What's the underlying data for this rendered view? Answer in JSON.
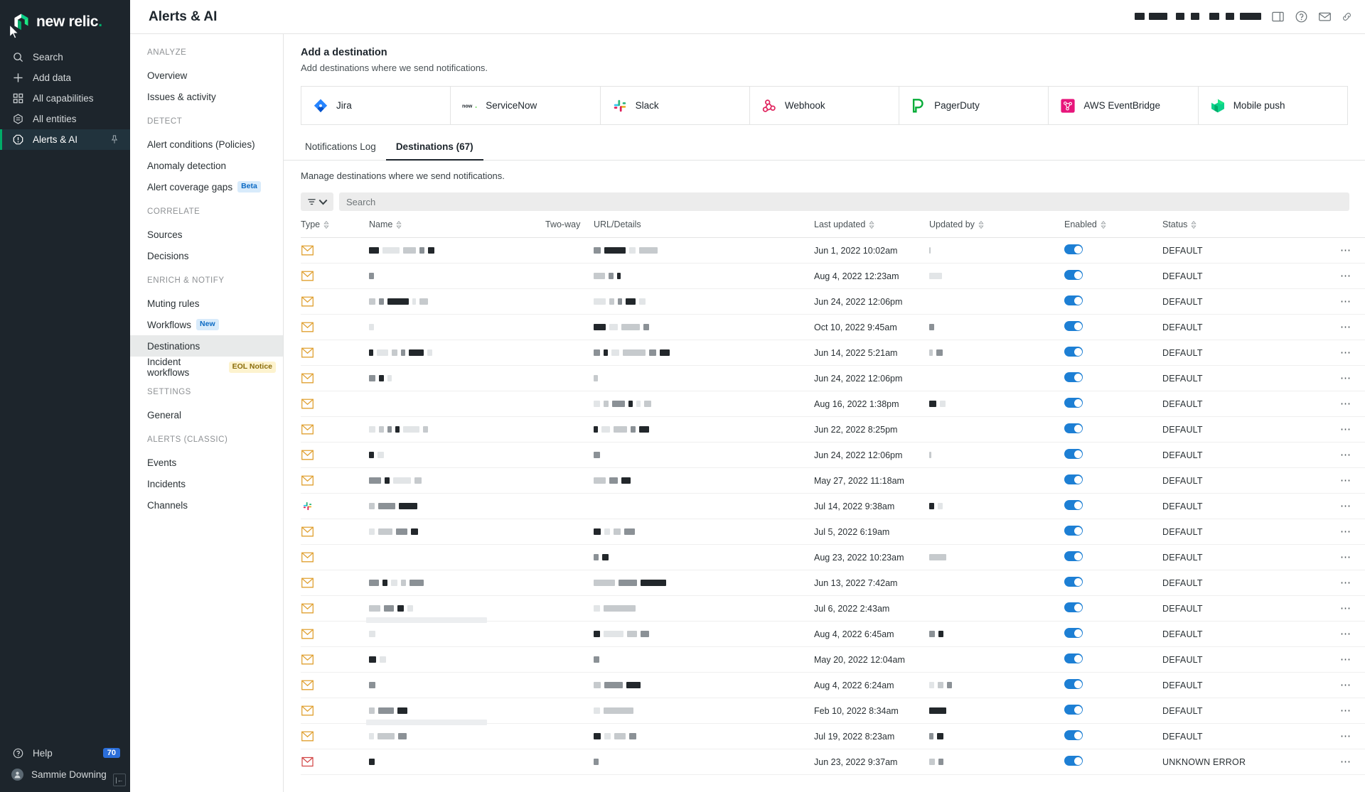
{
  "brand": {
    "name": "new relic",
    "accent": "#00ac69"
  },
  "primary_nav": {
    "items": [
      {
        "label": "Search",
        "icon": "search-icon"
      },
      {
        "label": "Add data",
        "icon": "plus-icon"
      },
      {
        "label": "All capabilities",
        "icon": "grid-icon"
      },
      {
        "label": "All entities",
        "icon": "hexagon-icon"
      },
      {
        "label": "Alerts & AI",
        "icon": "alert-octagon-icon",
        "active": true,
        "pinned": true
      }
    ],
    "help": {
      "label": "Help",
      "badge": "70",
      "icon": "help-circle-icon"
    },
    "user": {
      "label": "Sammie Downing",
      "icon": "avatar-icon"
    },
    "collapse": {
      "label": "|←"
    }
  },
  "header": {
    "title": "Alerts & AI",
    "icons": [
      "panel-icon",
      "help-circle-icon",
      "mail-icon",
      "link-icon"
    ]
  },
  "subnav": {
    "groups": [
      {
        "title": "ANALYZE",
        "items": [
          {
            "label": "Overview"
          },
          {
            "label": "Issues & activity"
          }
        ]
      },
      {
        "title": "DETECT",
        "items": [
          {
            "label": "Alert conditions (Policies)"
          },
          {
            "label": "Anomaly detection"
          },
          {
            "label": "Alert coverage gaps",
            "tag": "Beta",
            "tag_kind": "beta"
          }
        ]
      },
      {
        "title": "CORRELATE",
        "items": [
          {
            "label": "Sources"
          },
          {
            "label": "Decisions"
          }
        ]
      },
      {
        "title": "ENRICH & NOTIFY",
        "items": [
          {
            "label": "Muting rules"
          },
          {
            "label": "Workflows",
            "tag": "New",
            "tag_kind": "new"
          },
          {
            "label": "Destinations",
            "active": true
          },
          {
            "label": "Incident workflows",
            "tag": "EOL Notice",
            "tag_kind": "eol"
          }
        ]
      },
      {
        "title": "SETTINGS",
        "items": [
          {
            "label": "General"
          }
        ]
      },
      {
        "title": "ALERTS (CLASSIC)",
        "items": [
          {
            "label": "Events"
          },
          {
            "label": "Incidents"
          },
          {
            "label": "Channels"
          }
        ]
      }
    ]
  },
  "add_destination": {
    "title": "Add a destination",
    "subtitle": "Add destinations where we send notifications.",
    "cards": [
      {
        "label": "Jira",
        "logo": "jira-logo"
      },
      {
        "label": "ServiceNow",
        "logo": "servicenow-logo"
      },
      {
        "label": "Slack",
        "logo": "slack-logo"
      },
      {
        "label": "Webhook",
        "logo": "webhook-logo"
      },
      {
        "label": "PagerDuty",
        "logo": "pagerduty-logo"
      },
      {
        "label": "AWS EventBridge",
        "logo": "aws-eventbridge-logo"
      },
      {
        "label": "Mobile push",
        "logo": "mobile-push-logo"
      }
    ]
  },
  "tabs": [
    {
      "label": "Notifications Log",
      "active": false
    },
    {
      "label": "Destinations (67)",
      "active": true
    }
  ],
  "manage_text": "Manage destinations where we send notifications.",
  "toolbar": {
    "filter_label": "filter",
    "search_placeholder": "Search",
    "search_value": ""
  },
  "table": {
    "columns": [
      {
        "label": "Type",
        "sortable": true
      },
      {
        "label": "Name",
        "sortable": true
      },
      {
        "label": "Two-way",
        "sortable": false
      },
      {
        "label": "URL/Details",
        "sortable": false
      },
      {
        "label": "Last updated",
        "sortable": true
      },
      {
        "label": "Updated by",
        "sortable": true
      },
      {
        "label": "Enabled",
        "sortable": true
      },
      {
        "label": "Status",
        "sortable": true
      }
    ],
    "rows": [
      {
        "type": "email",
        "name_blocks": [
          14,
          24,
          18,
          7,
          9
        ],
        "url_blocks": [
          10,
          30,
          9,
          26
        ],
        "last_updated": "Jun 1, 2022 10:02am",
        "updated_by_blocks": [
          2
        ],
        "enabled": true,
        "status": "DEFAULT"
      },
      {
        "type": "email",
        "name_blocks": [
          7
        ],
        "url_blocks": [
          16,
          7,
          5
        ],
        "last_updated": "Aug 4, 2022 12:23am",
        "updated_by_blocks": [
          18
        ],
        "enabled": true,
        "status": "DEFAULT"
      },
      {
        "type": "email",
        "name_blocks": [
          9,
          7,
          30,
          5,
          12
        ],
        "url_blocks": [
          17,
          7,
          6,
          14,
          9
        ],
        "last_updated": "Jun 24, 2022 12:06pm",
        "updated_by_blocks": [],
        "enabled": true,
        "status": "DEFAULT"
      },
      {
        "type": "email",
        "name_blocks": [
          7
        ],
        "url_blocks": [
          17,
          12,
          26,
          8
        ],
        "last_updated": "Oct 10, 2022 9:45am",
        "updated_by_blocks": [
          7
        ],
        "enabled": true,
        "status": "DEFAULT"
      },
      {
        "type": "email",
        "name_blocks": [
          6,
          16,
          8,
          6,
          21,
          7
        ],
        "url_blocks": [
          9,
          6,
          11,
          32,
          10,
          14
        ],
        "last_updated": "Jun 14, 2022 5:21am",
        "updated_by_blocks": [
          5,
          9
        ],
        "enabled": true,
        "status": "DEFAULT"
      },
      {
        "type": "email",
        "name_blocks": [
          9,
          7,
          6
        ],
        "url_blocks": [
          6
        ],
        "last_updated": "Jun 24, 2022 12:06pm",
        "updated_by_blocks": [],
        "enabled": true,
        "status": "DEFAULT"
      },
      {
        "type": "email",
        "name_blocks": [],
        "url_blocks": [
          9,
          7,
          18,
          6,
          6,
          10
        ],
        "last_updated": "Aug 16, 2022 1:38pm",
        "updated_by_blocks": [
          10,
          8
        ],
        "enabled": true,
        "status": "DEFAULT"
      },
      {
        "type": "email",
        "name_blocks": [
          9,
          7,
          6,
          6,
          23,
          7
        ],
        "url_blocks": [
          6,
          12,
          19,
          7,
          14
        ],
        "last_updated": "Jun 22, 2022 8:25pm",
        "updated_by_blocks": [],
        "enabled": true,
        "status": "DEFAULT"
      },
      {
        "type": "email",
        "name_blocks": [
          7,
          9
        ],
        "url_blocks": [
          9
        ],
        "last_updated": "Jun 24, 2022 12:06pm",
        "updated_by_blocks": [
          3
        ],
        "enabled": true,
        "status": "DEFAULT"
      },
      {
        "type": "email",
        "name_blocks": [
          17,
          7,
          25,
          10
        ],
        "url_blocks": [
          17,
          12,
          13
        ],
        "last_updated": "May 27, 2022 11:18am",
        "updated_by_blocks": [],
        "enabled": true,
        "status": "DEFAULT"
      },
      {
        "type": "slack",
        "name_blocks": [
          8,
          24,
          26
        ],
        "url_blocks": [],
        "last_updated": "Jul 14, 2022 9:38am",
        "updated_by_blocks": [
          7,
          7
        ],
        "enabled": true,
        "status": "DEFAULT"
      },
      {
        "type": "email",
        "name_blocks": [
          8,
          20,
          16,
          10
        ],
        "url_blocks": [
          10,
          8,
          10,
          15
        ],
        "last_updated": "Jul 5, 2022 6:19am",
        "updated_by_blocks": [],
        "enabled": true,
        "status": "DEFAULT"
      },
      {
        "type": "email",
        "name_blocks": [],
        "url_blocks": [
          7,
          9
        ],
        "last_updated": "Aug 23, 2022 10:23am",
        "updated_by_blocks": [
          24
        ],
        "enabled": true,
        "status": "DEFAULT"
      },
      {
        "type": "email",
        "name_blocks": [
          14,
          7,
          9,
          7,
          20
        ],
        "url_blocks": [
          30,
          26,
          36
        ],
        "last_updated": "Jun 13, 2022 7:42am",
        "updated_by_blocks": [],
        "enabled": true,
        "status": "DEFAULT"
      },
      {
        "type": "email",
        "name_blocks": [
          16,
          14,
          9,
          8
        ],
        "url_blocks": [
          9,
          45
        ],
        "last_updated": "Jul 6, 2022 2:43am",
        "updated_by_blocks": [],
        "enabled": true,
        "status": "DEFAULT",
        "ghost": true
      },
      {
        "type": "email",
        "name_blocks": [
          9
        ],
        "url_blocks": [
          9,
          28,
          14,
          12
        ],
        "last_updated": "Aug 4, 2022 6:45am",
        "updated_by_blocks": [
          8,
          7
        ],
        "enabled": true,
        "status": "DEFAULT"
      },
      {
        "type": "email",
        "name_blocks": [
          10,
          9
        ],
        "url_blocks": [
          8
        ],
        "last_updated": "May 20, 2022 12:04am",
        "updated_by_blocks": [],
        "enabled": true,
        "status": "DEFAULT"
      },
      {
        "type": "email",
        "name_blocks": [
          9
        ],
        "url_blocks": [
          10,
          26,
          20
        ],
        "last_updated": "Aug 4, 2022 6:24am",
        "updated_by_blocks": [
          7,
          8,
          7
        ],
        "enabled": true,
        "status": "DEFAULT"
      },
      {
        "type": "email",
        "name_blocks": [
          8,
          22,
          14
        ],
        "url_blocks": [
          9,
          42
        ],
        "last_updated": "Feb 10, 2022 8:34am",
        "updated_by_blocks": [
          24
        ],
        "enabled": true,
        "status": "DEFAULT",
        "ghost": true
      },
      {
        "type": "email",
        "name_blocks": [
          7,
          24,
          12
        ],
        "url_blocks": [
          10,
          9,
          16,
          10
        ],
        "last_updated": "Jul 19, 2022 8:23am",
        "updated_by_blocks": [
          6,
          9
        ],
        "enabled": true,
        "status": "DEFAULT"
      },
      {
        "type": "error",
        "name_blocks": [
          8
        ],
        "url_blocks": [
          7
        ],
        "last_updated": "Jun 23, 2022 9:37am",
        "updated_by_blocks": [
          8,
          7
        ],
        "enabled": true,
        "status": "UNKNOWN ERROR"
      }
    ],
    "row_menu_label": "⋯"
  },
  "colors": {
    "toggle_on": "#1d7fd4",
    "sidebar_bg": "#1d252c",
    "accent_green": "#00ac69",
    "tag_blue_bg": "#d8ebfb",
    "tag_blue_text": "#0b6ac4",
    "tag_yellow_bg": "#fdf3cf",
    "tag_yellow_text": "#8a6d0b"
  }
}
